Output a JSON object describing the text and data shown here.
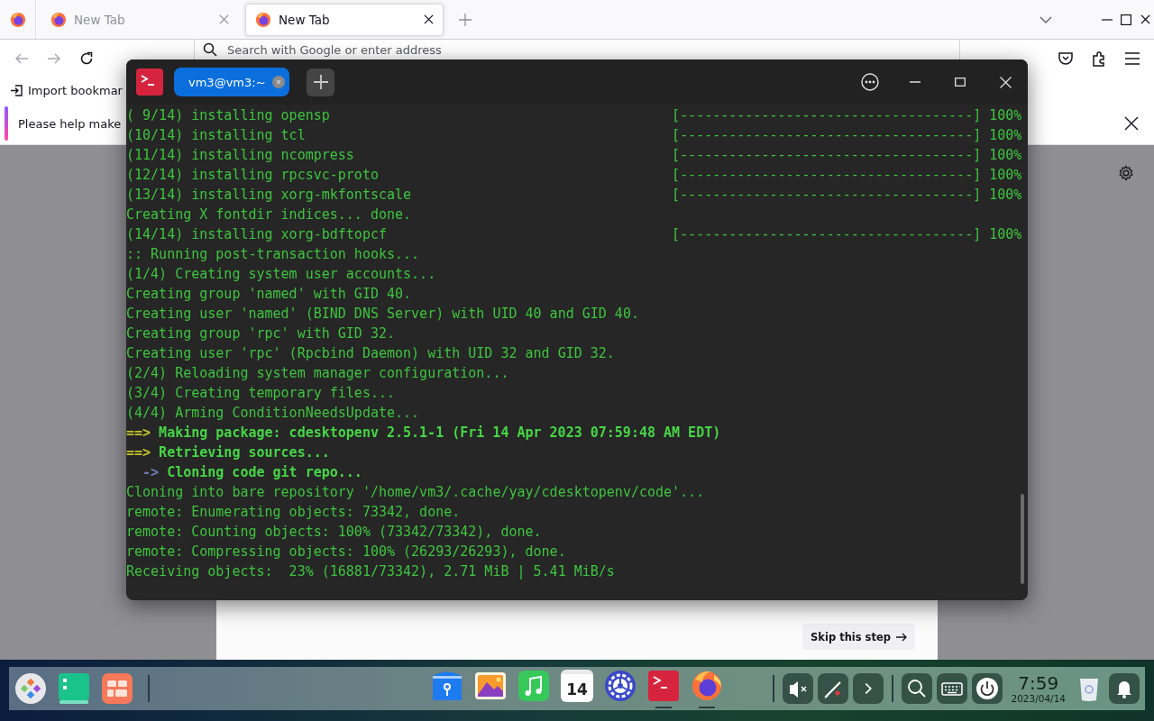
{
  "browser": {
    "tabs": [
      {
        "label": "New Tab",
        "selected": false
      },
      {
        "label": "New Tab",
        "selected": true
      }
    ],
    "nav_buttons": [
      {
        "kind": "back",
        "disabled": true
      },
      {
        "kind": "forward",
        "disabled": true
      },
      {
        "kind": "reload",
        "disabled": false
      }
    ],
    "address_bar": {
      "placeholder": "Search with Google or enter address"
    },
    "bookmarks": [
      {
        "label": "Import bookmar"
      }
    ],
    "notification": {
      "text": "Please help make"
    },
    "page": {
      "skip_button": "Skip this step"
    }
  },
  "terminal": {
    "tabs": [
      {
        "label": "vm3@vm3:~",
        "selected": true
      }
    ],
    "lines": [
      {
        "kind": "progress",
        "text": "( 9/14) installing opensp",
        "bar": "[------------------------------------]",
        "percent": "100%"
      },
      {
        "kind": "progress",
        "text": "(10/14) installing tcl",
        "bar": "[------------------------------------]",
        "percent": "100%"
      },
      {
        "kind": "progress",
        "text": "(11/14) installing ncompress",
        "bar": "[------------------------------------]",
        "percent": "100%"
      },
      {
        "kind": "progress",
        "text": "(12/14) installing rpcsvc-proto",
        "bar": "[------------------------------------]",
        "percent": "100%"
      },
      {
        "kind": "progress",
        "text": "(13/14) installing xorg-mkfontscale",
        "bar": "[------------------------------------]",
        "percent": "100%"
      },
      {
        "kind": "plain",
        "text": "Creating X fontdir indices... done."
      },
      {
        "kind": "progress",
        "text": "(14/14) installing xorg-bdftopcf",
        "bar": "[------------------------------------]",
        "percent": "100%"
      },
      {
        "kind": "plain",
        "text": ":: Running post-transaction hooks..."
      },
      {
        "kind": "plain",
        "text": "(1/4) Creating system user accounts..."
      },
      {
        "kind": "plain",
        "text": "Creating group 'named' with GID 40."
      },
      {
        "kind": "plain",
        "text": "Creating user 'named' (BIND DNS Server) with UID 40 and GID 40."
      },
      {
        "kind": "plain",
        "text": "Creating group 'rpc' with GID 32."
      },
      {
        "kind": "plain",
        "text": "Creating user 'rpc' (Rpcbind Daemon) with UID 32 and GID 32."
      },
      {
        "kind": "plain",
        "text": "(2/4) Reloading system manager configuration..."
      },
      {
        "kind": "plain",
        "text": "(3/4) Creating temporary files..."
      },
      {
        "kind": "plain",
        "text": "(4/4) Arming ConditionNeedsUpdate..."
      },
      {
        "kind": "section",
        "arrow": "==>",
        "text": "Making package: cdesktopenv 2.5.1-1 (Fri 14 Apr 2023 07:59:48 AM EDT)"
      },
      {
        "kind": "section",
        "arrow": "==>",
        "text": "Retrieving sources..."
      },
      {
        "kind": "step",
        "arrow": "->",
        "text": "Cloning code git repo..."
      },
      {
        "kind": "plain",
        "text": "Cloning into bare repository '/home/vm3/.cache/yay/cdesktopenv/code'..."
      },
      {
        "kind": "plain",
        "text": "remote: Enumerating objects: 73342, done."
      },
      {
        "kind": "plain",
        "text": "remote: Counting objects: 100% (73342/73342), done."
      },
      {
        "kind": "plain",
        "text": "remote: Compressing objects: 100% (26293/26293), done."
      },
      {
        "kind": "plain",
        "text": "Receiving objects:  23% (16881/73342), 2.71 MiB | 5.41 MiB/s"
      }
    ]
  },
  "taskbar": {
    "left": [
      {
        "kind": "launcher"
      },
      {
        "kind": "files"
      },
      {
        "kind": "multitask"
      }
    ],
    "apps": [
      {
        "kind": "store",
        "running": false
      },
      {
        "kind": "photos",
        "running": false
      },
      {
        "kind": "music",
        "running": false
      },
      {
        "kind": "calendar",
        "label": "14",
        "running": false
      },
      {
        "kind": "settings",
        "running": false
      },
      {
        "kind": "terminal",
        "running": true
      },
      {
        "kind": "browser",
        "running": true
      }
    ],
    "tray": [
      {
        "kind": "mute"
      },
      {
        "kind": "pen"
      },
      {
        "kind": "expand"
      },
      {
        "kind": "separator"
      },
      {
        "kind": "search"
      },
      {
        "kind": "keyboard"
      },
      {
        "kind": "power"
      }
    ],
    "clock": {
      "time": "7:59",
      "date": "2023/04/14"
    },
    "end": [
      {
        "kind": "trash"
      },
      {
        "kind": "notifications"
      }
    ]
  }
}
